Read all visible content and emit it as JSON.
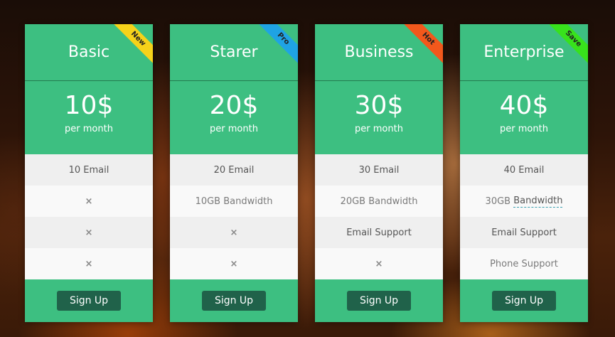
{
  "plans": [
    {
      "name": "Basic",
      "price": "10$",
      "period": "per month",
      "badge": "New",
      "badge_color": "#f6d21a",
      "features": [
        "10 Email",
        "×",
        "×",
        "×"
      ],
      "cta": "Sign Up"
    },
    {
      "name": "Starer",
      "price": "20$",
      "period": "per month",
      "badge": "Pro",
      "badge_color": "#1fa3e4",
      "features": [
        "20 Email",
        "10GB Bandwidth",
        "×",
        "×"
      ],
      "cta": "Sign Up"
    },
    {
      "name": "Business",
      "price": "30$",
      "period": "per month",
      "badge": "Hot",
      "badge_color": "#f2581c",
      "features": [
        "30 Email",
        "20GB Bandwidth",
        "Email Support",
        "×"
      ],
      "cta": "Sign Up"
    },
    {
      "name": "Enterprise",
      "price": "40$",
      "period": "per month",
      "badge": "Save",
      "badge_color": "#38e21c",
      "features": [
        "40 Email",
        "30GB",
        "Bandwidth",
        "Email Support",
        "Phone Support"
      ],
      "cta": "Sign Up"
    }
  ]
}
